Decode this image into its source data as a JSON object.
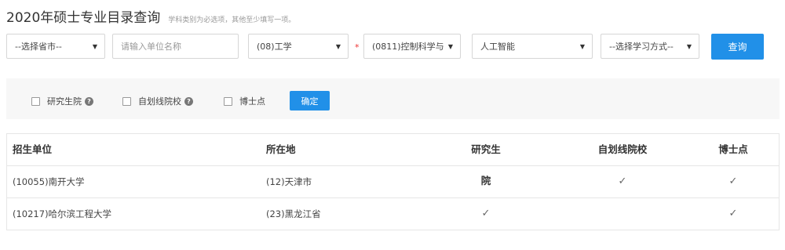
{
  "header": {
    "title": "2020年硕士专业目录查询",
    "note": "学科类别为必选项，其他至少填写一项。"
  },
  "search": {
    "province_select": "--选择省市--",
    "unit_placeholder": "请输入单位名称",
    "category_select": "(08)工学",
    "required_mark": "*",
    "discipline_select": "(0811)控制科学与",
    "major_select": "人工智能",
    "study_mode_select": "--选择学习方式--",
    "query_button": "查询"
  },
  "filters": {
    "graduate_school": "研究生院",
    "self_line": "自划线院校",
    "doctoral": "博士点",
    "confirm_button": "确定",
    "help_glyph": "?"
  },
  "table": {
    "headers": [
      "招生单位",
      "所在地",
      "研究生院",
      "自划线院校",
      "博士点"
    ],
    "rows": [
      {
        "unit": "(10055)南开大学",
        "location": "(12)天津市",
        "grad": "✓",
        "self": "✓",
        "doctor": "✓"
      },
      {
        "unit": "(10217)哈尔滨工程大学",
        "location": "(23)黑龙江省",
        "grad": "✓",
        "self": "",
        "doctor": "✓"
      }
    ]
  },
  "icons": {
    "caret": "▼",
    "caret_icon_name": "caret-down-icon",
    "help_icon_name": "help-circle-icon",
    "check_icon_name": "check-icon"
  },
  "colors": {
    "primary": "#2190e8",
    "required": "#ee3333",
    "filter_bg": "#f7f7f7"
  }
}
